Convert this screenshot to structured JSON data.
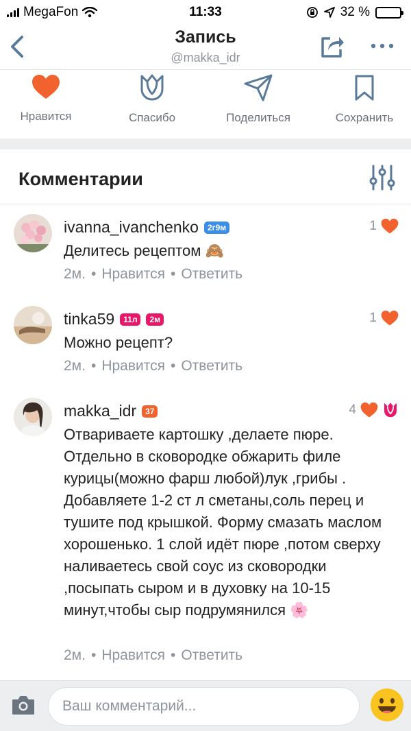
{
  "status_bar": {
    "carrier": "MegaFon",
    "time": "11:33",
    "battery": "32 %",
    "battery_level": 0.32
  },
  "header": {
    "title": "Запись",
    "subtitle": "@makka_idr"
  },
  "actions": [
    {
      "label": "Нравится",
      "icon": "heart-icon"
    },
    {
      "label": "Спасибо",
      "icon": "tulip-icon"
    },
    {
      "label": "Поделиться",
      "icon": "send-icon"
    },
    {
      "label": "Сохранить",
      "icon": "bookmark-icon"
    }
  ],
  "comments_section": {
    "title": "Комментарии",
    "comments": [
      {
        "username": "ivanna_ivanchenko",
        "badges": [
          {
            "text": "2г9м",
            "color": "#3a8ee6"
          }
        ],
        "likes": "1",
        "text": "Делитесь рецептом 🙈",
        "time": "2м.",
        "like_action": "Нравится",
        "reply_action": "Ответить"
      },
      {
        "username": "tinka59",
        "badges": [
          {
            "text": "11л",
            "color": "#e8176a"
          },
          {
            "text": "2м",
            "color": "#e8176a"
          }
        ],
        "likes": "1",
        "text": "Можно рецепт?",
        "time": "2м.",
        "like_action": "Нравится",
        "reply_action": "Ответить"
      },
      {
        "username": "makka_idr",
        "badges": [
          {
            "text": "37",
            "color": "#f2622e"
          }
        ],
        "likes": "4",
        "text": "Отвариваете картошку ,делаете пюре. Отдельно в сковородке обжарить филе курицы(можно фарш любой)лук ,грибы . Добавляете 1-2 ст л сметаны,соль перец и тушите под крышкой. Форму смазать маслом хорошенько. 1 слой идёт пюре ,потом сверху наливаетесь свой соус из сковородки ,посыпать сыром и в духовку на 10-15 минут,чтобы сыр подрумянился 🌸",
        "time": "2м.",
        "like_action": "Нравится",
        "reply_action": "Ответить"
      }
    ]
  },
  "composer": {
    "placeholder": "Ваш комментарий..."
  },
  "colors": {
    "accent_heart": "#f2622e",
    "icon_blue": "#5a7a99",
    "tulip_pink": "#e8176a",
    "muted": "#8e949c"
  }
}
